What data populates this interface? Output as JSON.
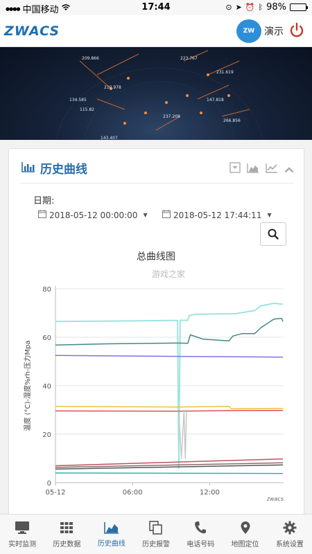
{
  "status_bar": {
    "carrier": "中国移动",
    "time": "17:44",
    "battery": "98%",
    "battery_level": 0.98
  },
  "header": {
    "logo": "ZWACS",
    "cloud_badge": "ZW",
    "demo_label": "演示"
  },
  "banner": {
    "labels": [
      "209.866",
      "223.767",
      "231.619",
      "210.978",
      "134.585",
      "147.818",
      "115.82",
      "237.208",
      "266.856",
      "143.407"
    ]
  },
  "panel": {
    "title": "历史曲线",
    "date_label": "日期:",
    "start_date": "2018-05-12 00:00:00",
    "end_date": "2018-05-12 17:44:11"
  },
  "chart_data": {
    "type": "line",
    "title": "总曲线图",
    "watermark": "游戏之家",
    "ylabel": "温度 (°C)-湿度%rh-压力Mpa",
    "xlabel": "",
    "ylim": [
      0,
      80
    ],
    "yticks": [
      "0",
      "20",
      "40",
      "60",
      "80"
    ],
    "xlim": [
      0,
      17.75
    ],
    "xticks": [
      {
        "label": "05-12",
        "x": 0
      },
      {
        "label": "06:00",
        "x": 6
      },
      {
        "label": "12:00",
        "x": 12
      }
    ],
    "credit": "zwacs",
    "series": [
      {
        "color": "#9fe3e0",
        "x": [
          0,
          9.5,
          9.6,
          9.7,
          10.3,
          10.4,
          11,
          14,
          15.5,
          16,
          17,
          17.7
        ],
        "y": [
          66.5,
          66.9,
          6,
          67,
          67,
          69,
          69.5,
          69.7,
          71,
          73,
          74,
          73.6
        ]
      },
      {
        "color": "#3f8a84",
        "x": [
          0,
          4,
          9.5,
          10.3,
          10.5,
          11.5,
          13.5,
          13.8,
          14.5,
          15.5,
          16,
          17,
          17.6,
          17.7
        ],
        "y": [
          56.8,
          57.3,
          57.6,
          57.5,
          61,
          59.2,
          58.5,
          60.5,
          61.5,
          61.5,
          64,
          67.5,
          67.8,
          66.5
        ]
      },
      {
        "color": "#7a73e8",
        "x": [
          0,
          17.7
        ],
        "y": [
          52.5,
          51.8
        ]
      },
      {
        "color": "#f0c040",
        "x": [
          0,
          9.5,
          13.5,
          13.7,
          17.7
        ],
        "y": [
          31.5,
          31.2,
          31.5,
          30.5,
          30.6
        ]
      },
      {
        "color": "#e05050",
        "x": [
          0,
          9.5,
          14.5,
          17.7
        ],
        "y": [
          29.6,
          29.5,
          29.8,
          29.8
        ]
      },
      {
        "color": "#c8c8c8",
        "x": [
          9.6,
          9.8,
          10.0,
          10.1,
          10.2
        ],
        "y": [
          29.5,
          10,
          30,
          10,
          29.5
        ]
      },
      {
        "color": "#c05060",
        "x": [
          0,
          17.7
        ],
        "y": [
          7,
          9.8
        ]
      },
      {
        "color": "#8a6a6a",
        "x": [
          0,
          17.7
        ],
        "y": [
          6.3,
          8.2
        ]
      },
      {
        "color": "#555555",
        "x": [
          0,
          17.7
        ],
        "y": [
          5.6,
          7.3
        ]
      },
      {
        "color": "#2bb5a8",
        "x": [
          0,
          17.7
        ],
        "y": [
          4,
          3.8
        ]
      }
    ]
  },
  "tabbar": {
    "items": [
      {
        "label": "实时监测",
        "icon": "monitor-icon"
      },
      {
        "label": "历史数据",
        "icon": "grid-icon"
      },
      {
        "label": "历史曲线",
        "icon": "area-chart-icon"
      },
      {
        "label": "历史报警",
        "icon": "copy-icon"
      },
      {
        "label": "电话号码",
        "icon": "phone-icon"
      },
      {
        "label": "地图定位",
        "icon": "map-pin-icon"
      },
      {
        "label": "系统设置",
        "icon": "gear-icon"
      }
    ],
    "active": 2
  }
}
